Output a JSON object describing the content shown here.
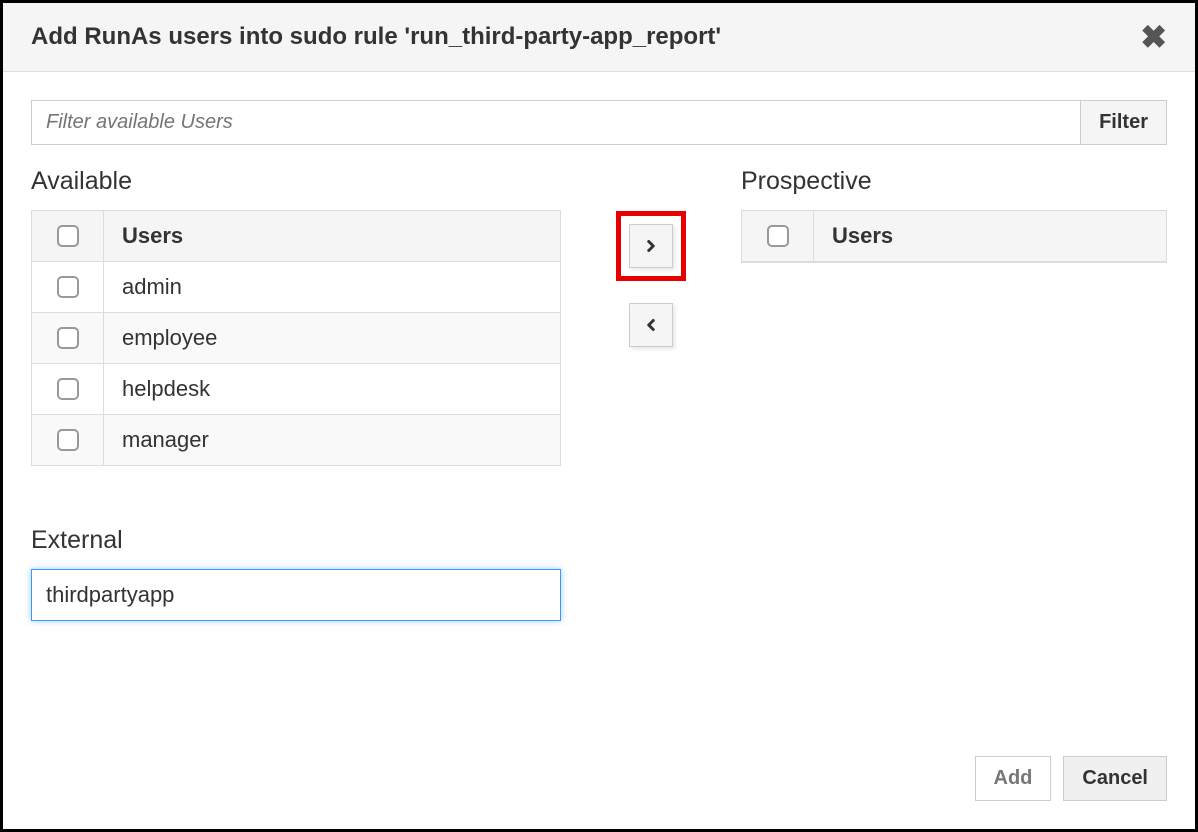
{
  "dialog": {
    "title": "Add RunAs users into sudo rule 'run_third-party-app_report'"
  },
  "filter": {
    "placeholder": "Filter available Users",
    "button_label": "Filter"
  },
  "available": {
    "heading": "Available",
    "column_header": "Users",
    "items": [
      "admin",
      "employee",
      "helpdesk",
      "manager"
    ]
  },
  "prospective": {
    "heading": "Prospective",
    "column_header": "Users",
    "items": []
  },
  "external": {
    "heading": "External",
    "value": "thirdpartyapp"
  },
  "footer": {
    "add_label": "Add",
    "cancel_label": "Cancel"
  }
}
